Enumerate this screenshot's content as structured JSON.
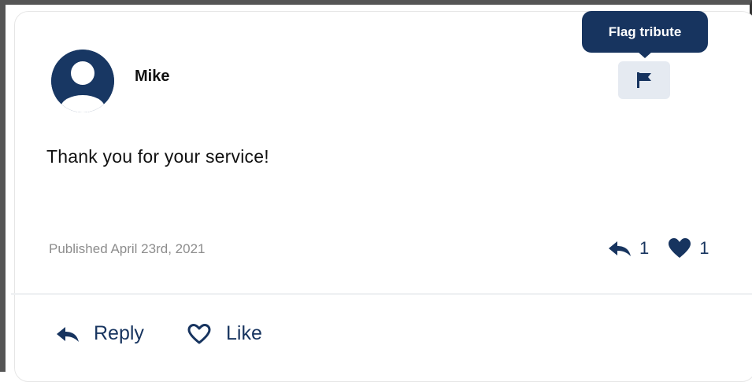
{
  "tribute": {
    "author": "Mike",
    "message": "Thank you for your service!",
    "published": "Published April 23rd, 2021",
    "reply_count": "1",
    "like_count": "1"
  },
  "tooltip": {
    "text": "Flag tribute"
  },
  "actions": {
    "reply_label": "Reply",
    "like_label": "Like"
  },
  "icons": {
    "avatar": "user-avatar-icon",
    "flag": "flag-icon",
    "reply": "reply-arrow-icon",
    "heart_filled": "heart-filled-icon",
    "heart_outline": "heart-outline-icon"
  },
  "colors": {
    "accent": "#17345f",
    "flag_button_bg": "#e5eaf1",
    "meta_text": "#8d8d8d"
  }
}
